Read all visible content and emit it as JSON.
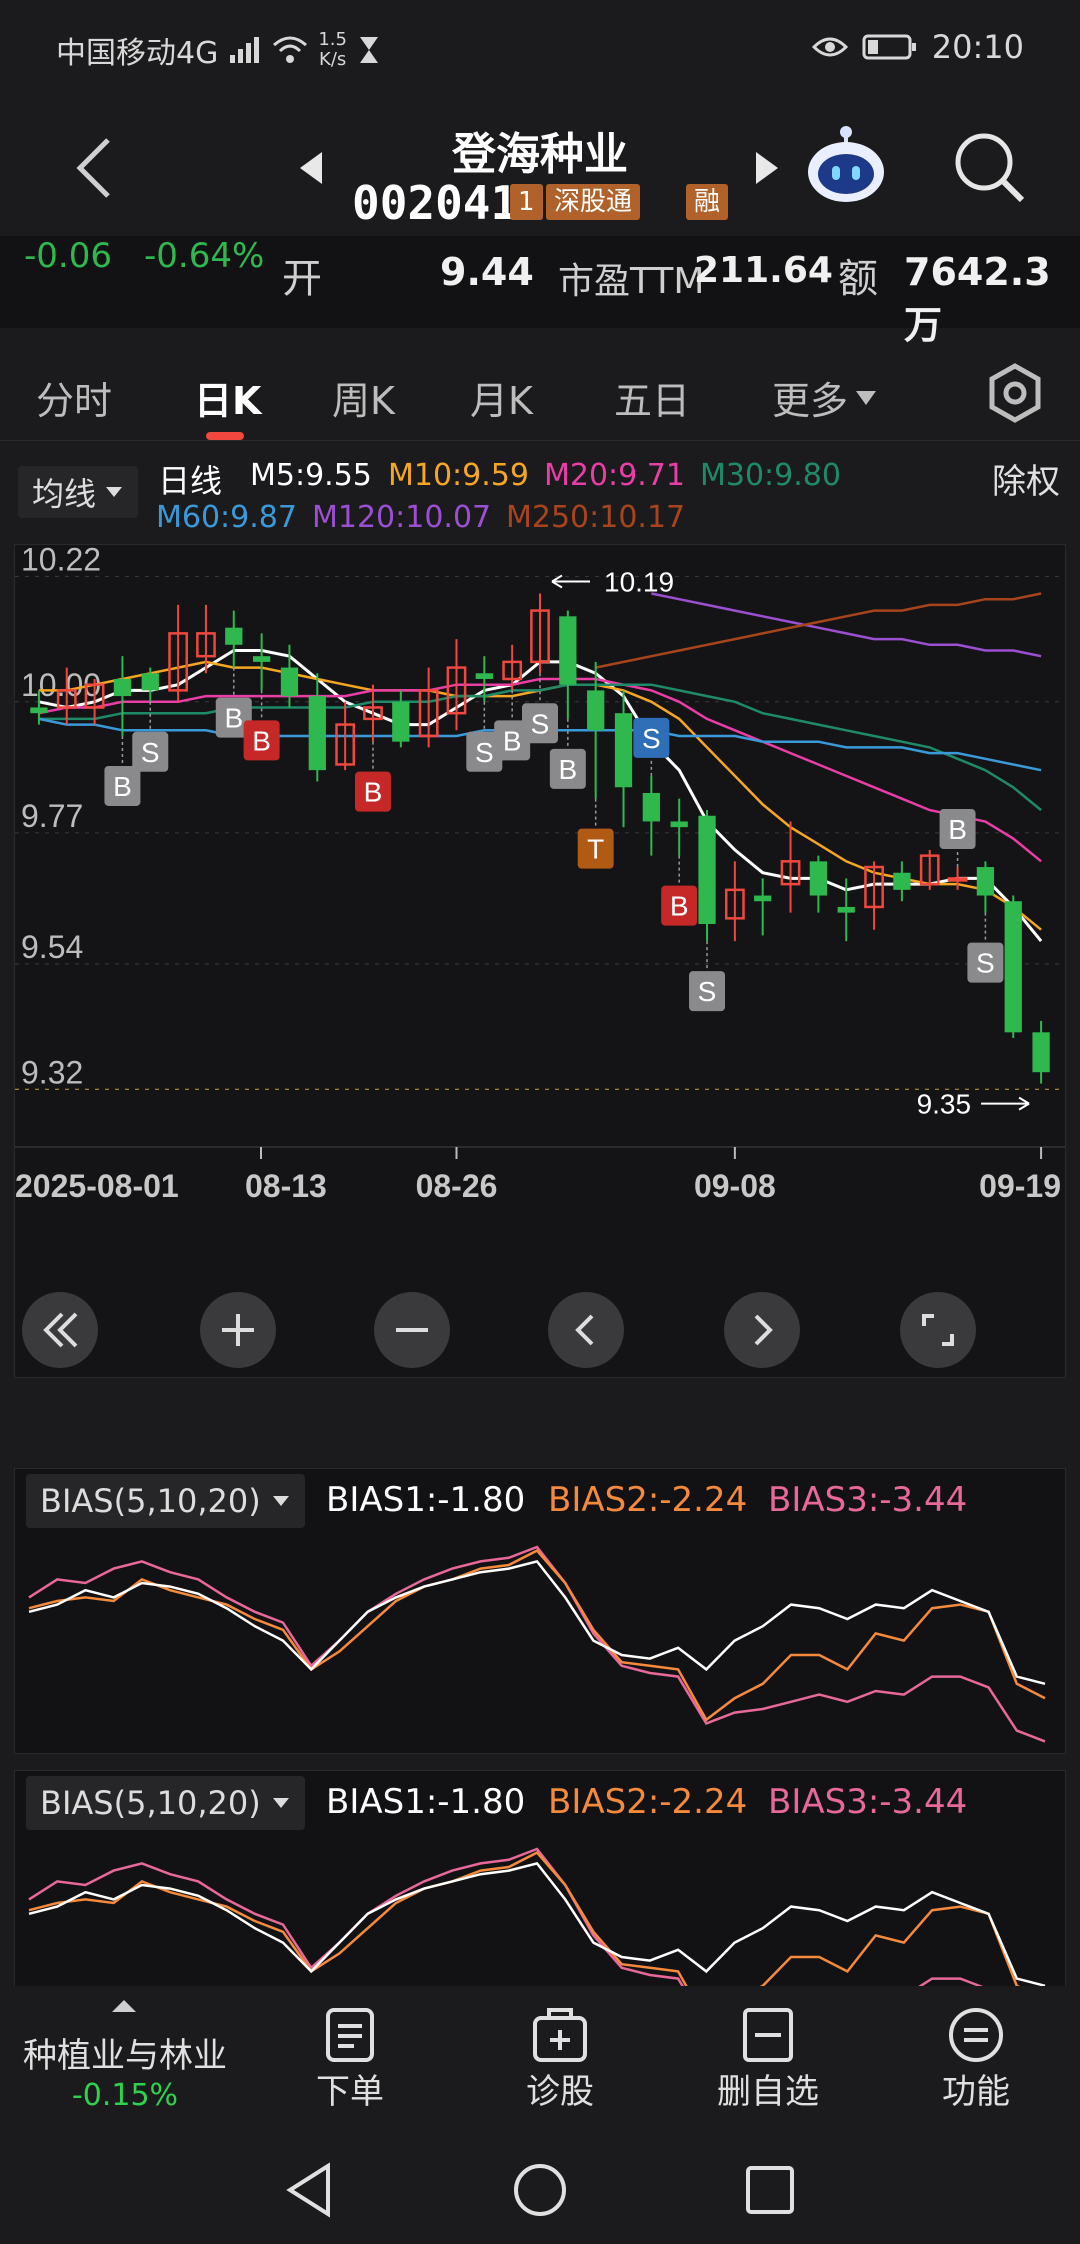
{
  "status_bar": {
    "carrier": "中国移动4G",
    "network_speed_value": "1.5",
    "network_speed_unit": "K/s",
    "time": "20:10"
  },
  "header": {
    "stock_name": "登海种业",
    "stock_code": "002041",
    "tag_level": "1",
    "tag_connect": "深股通",
    "tag_margin": "融"
  },
  "quote": {
    "change": "-0.06",
    "change_pct": "-0.64%",
    "open_label": "开",
    "open_value": "9.44",
    "pe_label": "市盈TTM",
    "pe_value": "211.64",
    "amount_label": "额",
    "amount_value": "7642.3万"
  },
  "tabs": [
    {
      "label": "分时"
    },
    {
      "label": "日K"
    },
    {
      "label": "周K"
    },
    {
      "label": "月K"
    },
    {
      "label": "五日"
    },
    {
      "label": "更多"
    }
  ],
  "ma_bar": {
    "selector": "均线",
    "period": "日线",
    "m5": "M5:9.55",
    "m10": "M10:9.59",
    "m20": "M20:9.71",
    "m30": "M30:9.80",
    "m60": "M60:9.87",
    "m120": "M120:10.07",
    "m250": "M250:10.17",
    "adjust": "除权"
  },
  "colors": {
    "m5": "#ffffff",
    "m10": "#f5a623",
    "m20": "#e83ea6",
    "m30": "#1f8a6a",
    "m60": "#3a9ad9",
    "m120": "#9b4fd1",
    "m250": "#a8441c",
    "up": "#f0483e",
    "down": "#2fb84e"
  },
  "chart_data": {
    "type": "candlestick",
    "title": "日K",
    "y_ticks": [
      "10.22",
      "10.00",
      "9.77",
      "9.54",
      "9.32"
    ],
    "x_ticks": [
      "2025-08-01",
      "08-13",
      "08-26",
      "09-08",
      "09-19"
    ],
    "high_marker": "10.19",
    "low_marker": "9.35",
    "last_price": 9.35,
    "ylim": [
      9.31,
      10.24
    ],
    "candles": [
      {
        "o": 9.99,
        "c": 9.98,
        "h": 10.02,
        "l": 9.96
      },
      {
        "o": 9.99,
        "c": 10.02,
        "h": 10.06,
        "l": 9.96
      },
      {
        "o": 9.99,
        "c": 10.03,
        "h": 10.04,
        "l": 9.96
      },
      {
        "o": 10.04,
        "c": 10.01,
        "h": 10.08,
        "l": 9.94
      },
      {
        "o": 10.05,
        "c": 10.02,
        "h": 10.06,
        "l": 10.0
      },
      {
        "o": 10.02,
        "c": 10.12,
        "h": 10.17,
        "l": 10.0
      },
      {
        "o": 10.08,
        "c": 10.12,
        "h": 10.17,
        "l": 10.05
      },
      {
        "o": 10.13,
        "c": 10.1,
        "h": 10.16,
        "l": 10.06
      },
      {
        "o": 10.08,
        "c": 10.07,
        "h": 10.12,
        "l": 10.02
      },
      {
        "o": 10.06,
        "c": 10.01,
        "h": 10.1,
        "l": 9.99
      },
      {
        "o": 10.01,
        "c": 9.88,
        "h": 10.05,
        "l": 9.86
      },
      {
        "o": 9.89,
        "c": 9.96,
        "h": 10.0,
        "l": 9.88
      },
      {
        "o": 9.97,
        "c": 9.99,
        "h": 10.03,
        "l": 9.93
      },
      {
        "o": 10.0,
        "c": 9.93,
        "h": 10.02,
        "l": 9.92
      },
      {
        "o": 9.94,
        "c": 10.02,
        "h": 10.06,
        "l": 9.92
      },
      {
        "o": 9.98,
        "c": 10.06,
        "h": 10.11,
        "l": 9.95
      },
      {
        "o": 10.05,
        "c": 10.04,
        "h": 10.08,
        "l": 10.0
      },
      {
        "o": 10.04,
        "c": 10.07,
        "h": 10.1,
        "l": 10.02
      },
      {
        "o": 10.07,
        "c": 10.16,
        "h": 10.19,
        "l": 10.05
      },
      {
        "o": 10.15,
        "c": 10.03,
        "h": 10.16,
        "l": 9.97
      },
      {
        "o": 10.02,
        "c": 9.95,
        "h": 10.07,
        "l": 9.83
      },
      {
        "o": 9.98,
        "c": 9.85,
        "h": 10.02,
        "l": 9.78
      },
      {
        "o": 9.84,
        "c": 9.79,
        "h": 9.87,
        "l": 9.73
      },
      {
        "o": 9.79,
        "c": 9.78,
        "h": 9.83,
        "l": 9.73
      },
      {
        "o": 9.8,
        "c": 9.61,
        "h": 9.81,
        "l": 9.58
      },
      {
        "o": 9.62,
        "c": 9.67,
        "h": 9.72,
        "l": 9.58
      },
      {
        "o": 9.66,
        "c": 9.65,
        "h": 9.69,
        "l": 9.59
      },
      {
        "o": 9.68,
        "c": 9.72,
        "h": 9.79,
        "l": 9.63
      },
      {
        "o": 9.72,
        "c": 9.66,
        "h": 9.73,
        "l": 9.63
      },
      {
        "o": 9.64,
        "c": 9.63,
        "h": 9.69,
        "l": 9.58
      },
      {
        "o": 9.64,
        "c": 9.71,
        "h": 9.72,
        "l": 9.6
      },
      {
        "o": 9.7,
        "c": 9.67,
        "h": 9.72,
        "l": 9.65
      },
      {
        "o": 9.68,
        "c": 9.73,
        "h": 9.74,
        "l": 9.67
      },
      {
        "o": 9.69,
        "c": 9.69,
        "h": 9.71,
        "l": 9.67
      },
      {
        "o": 9.71,
        "c": 9.66,
        "h": 9.72,
        "l": 9.63
      },
      {
        "o": 9.65,
        "c": 9.42,
        "h": 9.66,
        "l": 9.41
      },
      {
        "o": 9.42,
        "c": 9.35,
        "h": 9.44,
        "l": 9.33
      }
    ],
    "ma_lines": [
      {
        "name": "M5",
        "from": 0,
        "values": [
          10.0,
          9.99,
          10.0,
          10.02,
          10.02,
          10.03,
          10.06,
          10.09,
          10.09,
          10.08,
          10.04,
          10.0,
          9.98,
          9.96,
          9.96,
          9.99,
          10.02,
          10.03,
          10.07,
          10.07,
          10.05,
          10.01,
          9.93,
          9.88,
          9.79,
          9.74,
          9.7,
          9.69,
          9.69,
          9.67,
          9.68,
          9.68,
          9.68,
          9.69,
          9.69,
          9.64,
          9.58
        ]
      },
      {
        "name": "M10",
        "from": 0,
        "values": [
          10.02,
          10.02,
          10.03,
          10.04,
          10.05,
          10.06,
          10.07,
          10.06,
          10.06,
          10.05,
          10.04,
          10.03,
          10.02,
          10.02,
          10.02,
          10.01,
          10.01,
          10.01,
          10.02,
          10.03,
          10.03,
          10.02,
          10.0,
          9.97,
          9.92,
          9.87,
          9.82,
          9.78,
          9.75,
          9.72,
          9.7,
          9.69,
          9.68,
          9.68,
          9.67,
          9.64,
          9.6
        ]
      },
      {
        "name": "M20",
        "from": 0,
        "values": [
          9.98,
          9.99,
          9.99,
          10.0,
          10.0,
          10.0,
          10.01,
          10.01,
          10.01,
          10.01,
          10.01,
          10.01,
          10.02,
          10.02,
          10.02,
          10.03,
          10.03,
          10.03,
          10.04,
          10.04,
          10.04,
          10.03,
          10.02,
          10.0,
          9.97,
          9.95,
          9.93,
          9.91,
          9.89,
          9.87,
          9.85,
          9.83,
          9.81,
          9.8,
          9.79,
          9.76,
          9.72
        ]
      },
      {
        "name": "M30",
        "from": 0,
        "values": [
          9.97,
          9.97,
          9.97,
          9.98,
          9.98,
          9.98,
          9.98,
          9.99,
          9.99,
          9.99,
          9.99,
          9.99,
          10.0,
          10.0,
          10.0,
          10.01,
          10.01,
          10.02,
          10.02,
          10.03,
          10.03,
          10.03,
          10.03,
          10.02,
          10.01,
          10.0,
          9.98,
          9.97,
          9.96,
          9.95,
          9.94,
          9.93,
          9.92,
          9.9,
          9.88,
          9.85,
          9.81
        ]
      },
      {
        "name": "M60",
        "from": 0,
        "values": [
          9.97,
          9.96,
          9.96,
          9.95,
          9.95,
          9.95,
          9.95,
          9.94,
          9.94,
          9.94,
          9.94,
          9.94,
          9.94,
          9.94,
          9.94,
          9.94,
          9.95,
          9.95,
          9.95,
          9.95,
          9.95,
          9.95,
          9.95,
          9.94,
          9.94,
          9.94,
          9.93,
          9.93,
          9.93,
          9.92,
          9.92,
          9.92,
          9.91,
          9.91,
          9.9,
          9.89,
          9.88
        ]
      },
      {
        "name": "M120",
        "from": 22,
        "values": [
          10.19,
          10.18,
          10.17,
          10.16,
          10.15,
          10.14,
          10.13,
          10.12,
          10.11,
          10.11,
          10.1,
          10.1,
          10.09,
          10.09,
          10.08
        ]
      },
      {
        "name": "M250",
        "from": 20,
        "values": [
          10.06,
          10.07,
          10.08,
          10.09,
          10.1,
          10.11,
          10.12,
          10.13,
          10.14,
          10.15,
          10.16,
          10.16,
          10.17,
          10.17,
          10.18,
          10.18,
          10.19
        ]
      }
    ],
    "signals": [
      {
        "i": 3,
        "label": "B",
        "kind": "gray",
        "pos": "below"
      },
      {
        "i": 4,
        "label": "S",
        "kind": "gray",
        "pos": "below"
      },
      {
        "i": 7,
        "label": "B",
        "kind": "gray",
        "pos": "below"
      },
      {
        "i": 8,
        "label": "B",
        "kind": "red",
        "pos": "below"
      },
      {
        "i": 12,
        "label": "B",
        "kind": "red",
        "pos": "below"
      },
      {
        "i": 16,
        "label": "S",
        "kind": "gray",
        "pos": "below"
      },
      {
        "i": 17,
        "label": "B",
        "kind": "gray",
        "pos": "below"
      },
      {
        "i": 18,
        "label": "S",
        "kind": "gray",
        "pos": "below"
      },
      {
        "i": 19,
        "label": "B",
        "kind": "gray",
        "pos": "below"
      },
      {
        "i": 20,
        "label": "T",
        "kind": "orange",
        "pos": "below"
      },
      {
        "i": 22,
        "label": "S",
        "kind": "blue",
        "pos": "above"
      },
      {
        "i": 23,
        "label": "B",
        "kind": "red",
        "pos": "below"
      },
      {
        "i": 24,
        "label": "S",
        "kind": "gray",
        "pos": "below"
      },
      {
        "i": 33,
        "label": "B",
        "kind": "gray",
        "pos": "above"
      },
      {
        "i": 34,
        "label": "S",
        "kind": "gray",
        "pos": "below"
      }
    ]
  },
  "bias_panels": [
    {
      "selector": "BIAS(5,10,20)",
      "bias1": "BIAS1:-1.80",
      "bias2": "BIAS2:-2.24",
      "bias3": "BIAS3:-3.44"
    },
    {
      "selector": "BIAS(5,10,20)",
      "bias1": "BIAS1:-1.80",
      "bias2": "BIAS2:-2.24",
      "bias3": "BIAS3:-3.44"
    }
  ],
  "bias_data": {
    "bias1": [
      0.2,
      0.4,
      0.8,
      0.6,
      1.0,
      0.9,
      0.7,
      0.3,
      -0.2,
      -0.6,
      -1.4,
      -0.6,
      0.2,
      0.6,
      0.9,
      1.1,
      1.3,
      1.4,
      1.6,
      0.6,
      -0.6,
      -1.0,
      -1.1,
      -0.8,
      -1.4,
      -0.6,
      -0.2,
      0.4,
      0.3,
      0.0,
      0.4,
      0.3,
      0.8,
      0.5,
      0.2,
      -1.6,
      -1.8
    ],
    "bias2": [
      0.3,
      0.5,
      0.6,
      0.5,
      1.1,
      0.8,
      0.6,
      0.4,
      0.0,
      -0.3,
      -1.4,
      -0.9,
      -0.2,
      0.5,
      0.9,
      1.1,
      1.4,
      1.5,
      1.9,
      1.0,
      -0.3,
      -1.2,
      -1.3,
      -1.4,
      -2.8,
      -2.2,
      -1.8,
      -1.0,
      -1.0,
      -1.4,
      -0.4,
      -0.6,
      0.3,
      0.4,
      0.2,
      -1.8,
      -2.2
    ],
    "bias3": [
      0.6,
      1.1,
      1.0,
      1.4,
      1.6,
      1.3,
      1.1,
      0.6,
      0.2,
      -0.1,
      -1.3,
      -0.6,
      0.2,
      0.7,
      1.1,
      1.4,
      1.6,
      1.7,
      2.0,
      1.0,
      -0.4,
      -1.3,
      -1.5,
      -1.6,
      -2.9,
      -2.6,
      -2.5,
      -2.3,
      -2.1,
      -2.3,
      -2.0,
      -2.1,
      -1.6,
      -1.6,
      -1.9,
      -3.1,
      -3.4
    ]
  },
  "chart_controls": [
    {
      "icon": "double-left-icon"
    },
    {
      "icon": "zoom-in-icon"
    },
    {
      "icon": "zoom-out-icon"
    },
    {
      "icon": "prev-icon"
    },
    {
      "icon": "next-icon"
    },
    {
      "icon": "fullscreen-icon"
    }
  ],
  "bottom_nav": {
    "sector_name": "种植业与林业",
    "sector_change": "-0.15%",
    "items": [
      {
        "label": "下单"
      },
      {
        "label": "诊股"
      },
      {
        "label": "删自选"
      },
      {
        "label": "功能"
      }
    ]
  }
}
